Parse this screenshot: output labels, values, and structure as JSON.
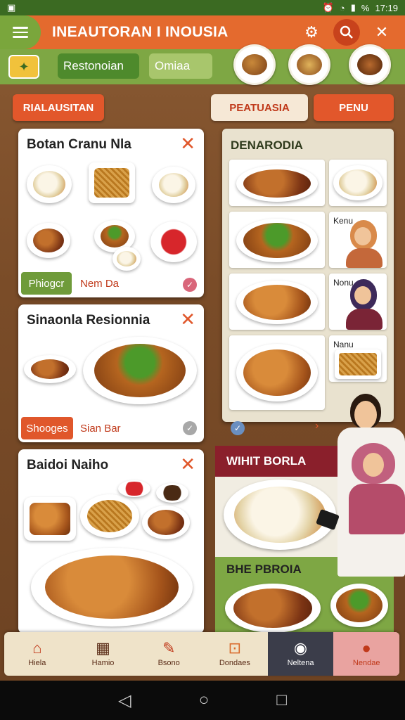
{
  "status_bar": {
    "left_icon": "image-icon",
    "battery_pct": "%",
    "time": "17:19"
  },
  "header": {
    "title": "INEAUTORAN I INOUSIA",
    "icons": [
      "settings-icon",
      "search-icon",
      "close-icon"
    ]
  },
  "subnav": {
    "chip_1": "Restonoian",
    "chip_2": "Omiaa"
  },
  "actions": {
    "left_button": "RIALAUSITAN",
    "cream_button": "PEATUASIA",
    "right_button": "PENU"
  },
  "cards": [
    {
      "title": "Botan Cranu Nla",
      "tag_button": "Phiogcr",
      "tag_label": "Nem Da"
    },
    {
      "title": "Sinaonla Resionnia",
      "tag_button": "Shooges",
      "tag_label": "Sian Bar"
    },
    {
      "title": "Baidoi Naiho"
    }
  ],
  "right_panel": {
    "title": "DENARODIA",
    "tiles": [
      "Kenu",
      "Nonu",
      "Nanu"
    ]
  },
  "sections": {
    "maroon_title": "WIHIT BORLA",
    "second_title": "BHE PBROIA"
  },
  "bottom_nav": [
    {
      "label": "Hiela",
      "icon": "home-icon"
    },
    {
      "label": "Hamio",
      "icon": "grid-icon"
    },
    {
      "label": "Bsono",
      "icon": "utensils-icon"
    },
    {
      "label": "Dondaes",
      "icon": "basket-icon"
    },
    {
      "label": "Neltena",
      "icon": "pot-icon"
    },
    {
      "label": "Nendae",
      "icon": "chef-icon"
    }
  ],
  "colors": {
    "header": "#e46a2e",
    "green": "#7ea744",
    "maroon": "#8a1f2b",
    "accent": "#e0572b"
  }
}
